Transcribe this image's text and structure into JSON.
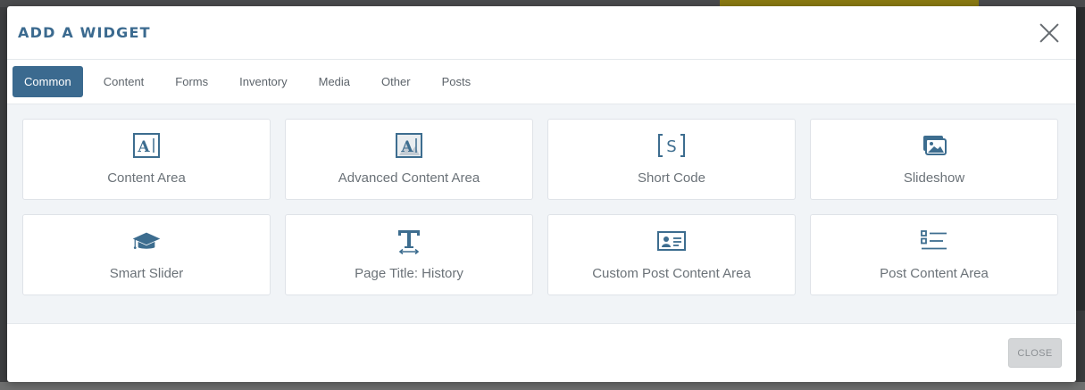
{
  "modal": {
    "title": "ADD A WIDGET",
    "close_icon": "close-icon"
  },
  "tabs": [
    {
      "label": "Common",
      "active": true
    },
    {
      "label": "Content",
      "active": false
    },
    {
      "label": "Forms",
      "active": false
    },
    {
      "label": "Inventory",
      "active": false
    },
    {
      "label": "Media",
      "active": false
    },
    {
      "label": "Other",
      "active": false
    },
    {
      "label": "Posts",
      "active": false
    }
  ],
  "widgets": [
    {
      "label": "Content Area",
      "icon": "content-area-icon"
    },
    {
      "label": "Advanced Content Area",
      "icon": "advanced-content-area-icon"
    },
    {
      "label": "Short Code",
      "icon": "shortcode-icon"
    },
    {
      "label": "Slideshow",
      "icon": "images-icon"
    },
    {
      "label": "Smart Slider",
      "icon": "graduation-cap-icon"
    },
    {
      "label": "Page Title: History",
      "icon": "text-height-icon"
    },
    {
      "label": "Custom Post Content Area",
      "icon": "id-card-icon"
    },
    {
      "label": "Post Content Area",
      "icon": "list-icon"
    }
  ],
  "footer": {
    "close_label": "CLOSE"
  },
  "colors": {
    "accent": "#3b6a8f",
    "icon": "#3d6d8f",
    "label": "#6b7278"
  }
}
